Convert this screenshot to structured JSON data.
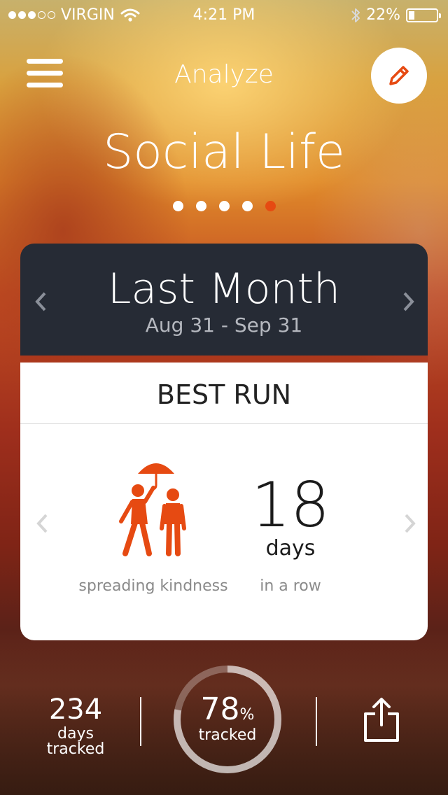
{
  "status_bar": {
    "carrier": "VIRGIN",
    "signal_bars_filled": 3,
    "signal_bars_total": 5,
    "time": "4:21 PM",
    "battery": "22%",
    "battery_level": 0.22
  },
  "header": {
    "title": "Analyze",
    "menu_icon": "hamburger-menu-icon",
    "edit_icon": "pencil-icon"
  },
  "category": {
    "title": "Social Life",
    "pages_total": 5,
    "active_page": 5
  },
  "card": {
    "period": "Last Month",
    "range": "Aug 31 - Sep 31",
    "metric_title": "BEST RUN",
    "activity_label": "spreading kindness",
    "activity_icon": "umbrella-people-icon",
    "count": "18",
    "unit": "days",
    "row_label": "in a row"
  },
  "footer": {
    "days_tracked": "234",
    "days_label_1": "days",
    "days_label_2": "tracked",
    "tracked_percent": "78",
    "percent_sign": "%",
    "tracked_label": "tracked",
    "tracked_fraction": 0.78,
    "share_icon": "share-icon"
  },
  "colors": {
    "accent": "#e64a12",
    "card_header": "#262b35"
  }
}
